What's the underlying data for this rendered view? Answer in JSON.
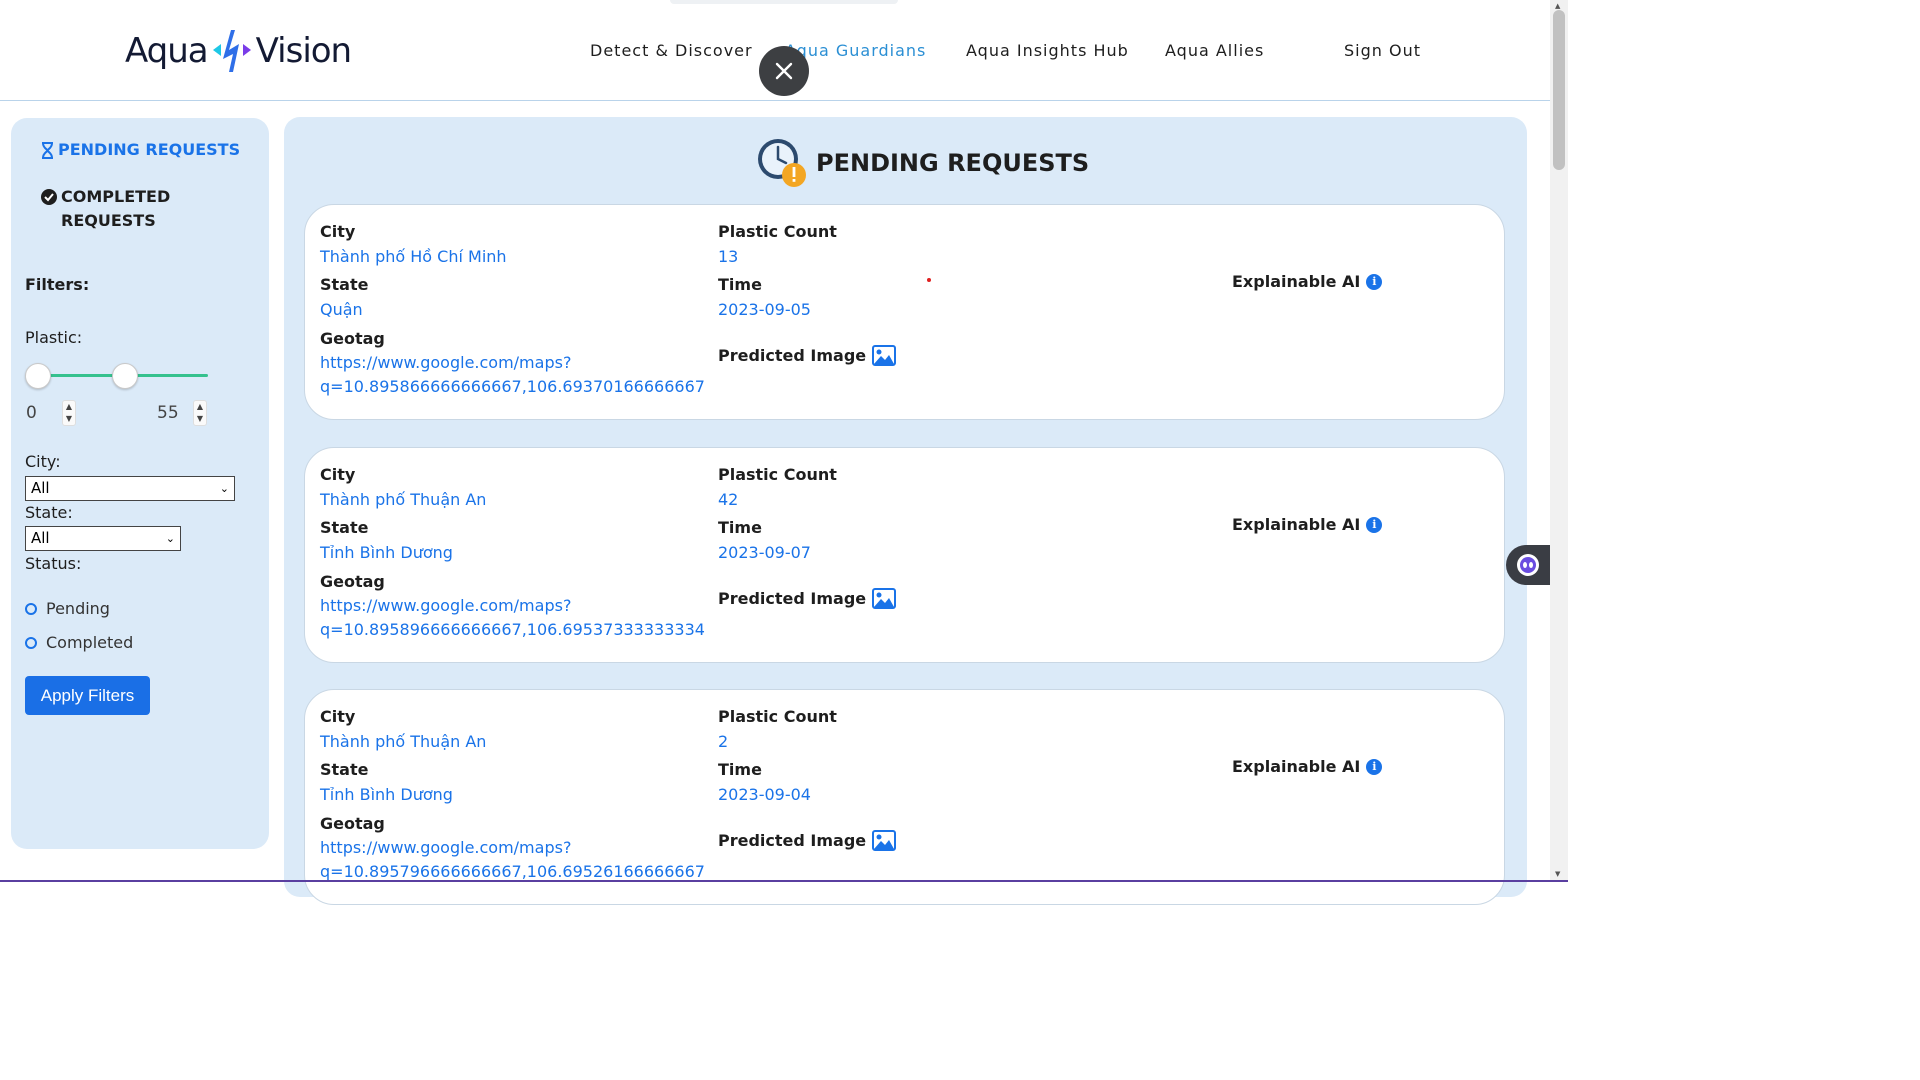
{
  "brand": {
    "left": "Aqua",
    "right": "Vision"
  },
  "nav": {
    "items": [
      "Detect & Discover",
      "Aqua Guardians",
      "Aqua Insights Hub",
      "Aqua Allies"
    ],
    "sign_out": "Sign Out"
  },
  "sidebar": {
    "pending_label": "PENDING REQUESTS",
    "completed_label_1": "COMPLETED",
    "completed_label_2": "REQUESTS",
    "filters_title": "Filters:",
    "plastic_label": "Plastic:",
    "plastic_min": "0",
    "plastic_max": "55",
    "city_label": "City:",
    "city_value": "All",
    "state_label": "State:",
    "state_value": "All",
    "status_label": "Status:",
    "status_options": [
      "Pending",
      "Completed"
    ],
    "apply_label": "Apply Filters"
  },
  "main": {
    "title": "PENDING REQUESTS",
    "labels": {
      "city": "City",
      "state": "State",
      "geotag": "Geotag",
      "plastic_count": "Plastic Count",
      "time": "Time",
      "predicted_image": "Predicted Image",
      "explainable_ai": "Explainable AI"
    },
    "requests": [
      {
        "city": "Thành phố Hồ Chí Minh",
        "state": "Quận",
        "geotag_1": "https://www.google.com/maps?",
        "geotag_2": "q=10.895866666666667,106.69370166666667",
        "plastic_count": "13",
        "time": "2023-09-05"
      },
      {
        "city": "Thành phố Thuận An",
        "state": "Tỉnh Bình Dương",
        "geotag_1": "https://www.google.com/maps?",
        "geotag_2": "q=10.895896666666667,106.69537333333334",
        "plastic_count": "42",
        "time": "2023-09-07"
      },
      {
        "city": "Thành phố Thuận An",
        "state": "Tỉnh Bình Dương",
        "geotag_1": "https://www.google.com/maps?",
        "geotag_2": "q=10.895796666666667,106.69526166666667",
        "plastic_count": "2",
        "time": "2023-09-04"
      }
    ]
  },
  "colors": {
    "accent": "#1a73e8",
    "panel": "#dbeaf8",
    "slider": "#35c18e"
  }
}
